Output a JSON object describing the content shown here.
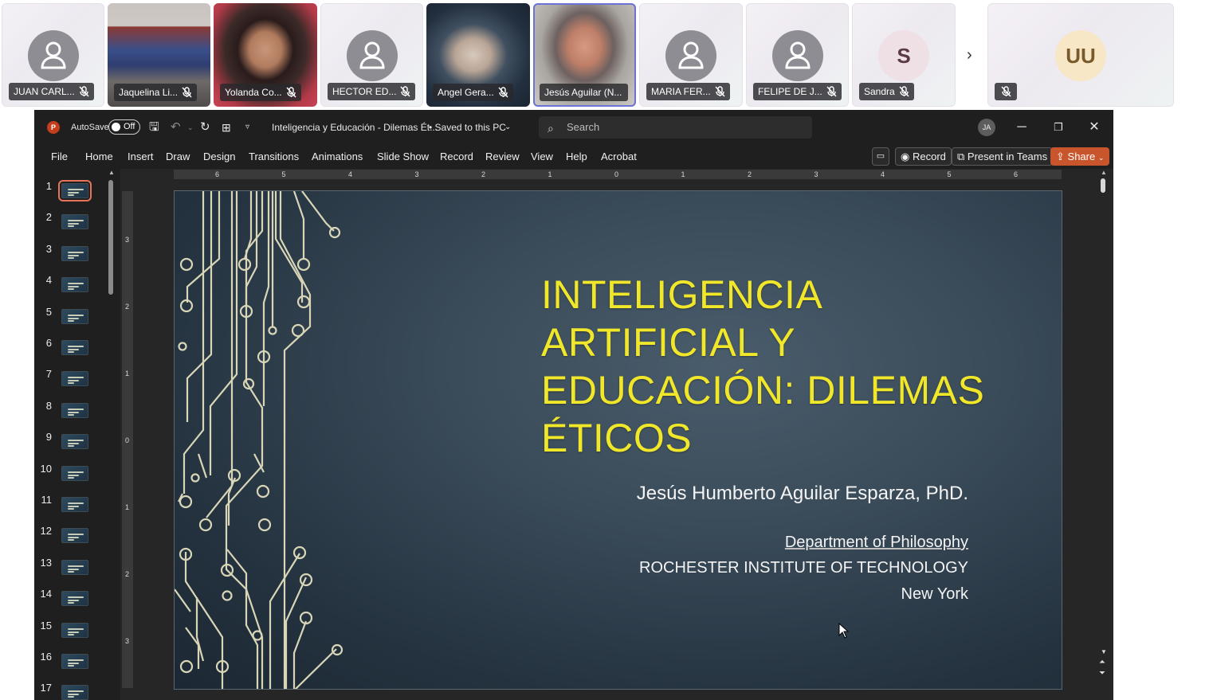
{
  "participants": [
    {
      "name": "JUAN CARL...",
      "kind": "placeholder"
    },
    {
      "name": "Jaquelina Li...",
      "kind": "video"
    },
    {
      "name": "Yolanda Co...",
      "kind": "video"
    },
    {
      "name": "HECTOR ED...",
      "kind": "placeholder"
    },
    {
      "name": "Angel Gera...",
      "kind": "video"
    },
    {
      "name": "Jesús Aguilar (N...",
      "kind": "video"
    },
    {
      "name": "MARIA FER...",
      "kind": "placeholder"
    },
    {
      "name": "FELIPE DE J...",
      "kind": "placeholder"
    },
    {
      "name": "Sandra",
      "kind": "initial",
      "initial": "S"
    },
    {
      "name": "",
      "kind": "initial",
      "initial": "UU"
    }
  ],
  "more_participants_icon": "chevron-right-icon",
  "window": {
    "app_logo": "P",
    "autosave_label": "AutoSave",
    "autosave_state": "Off",
    "doc_title": "Inteligencia y Educación - Dilemas Ét...",
    "save_status": "• Saved to this PC",
    "search_placeholder": "Search",
    "account_initials": "JA"
  },
  "menu": [
    "File",
    "Home",
    "Insert",
    "Draw",
    "Design",
    "Transitions",
    "Animations",
    "Slide Show",
    "Record",
    "Review",
    "View",
    "Help",
    "Acrobat"
  ],
  "ribbon_buttons": {
    "record": "Record",
    "present": "Present in Teams",
    "share": "Share"
  },
  "thumbnails": [
    "1",
    "2",
    "3",
    "4",
    "5",
    "6",
    "7",
    "8",
    "9",
    "10",
    "11",
    "12",
    "13",
    "14",
    "15",
    "16",
    "17"
  ],
  "selected_slide": 1,
  "ruler_h": [
    "6",
    "5",
    "4",
    "3",
    "2",
    "1",
    "0",
    "1",
    "2",
    "3",
    "4",
    "5",
    "6"
  ],
  "ruler_v": [
    "3",
    "2",
    "1",
    "0",
    "1",
    "2",
    "3"
  ],
  "slide": {
    "title": "INTELIGENCIA ARTIFICIAL Y EDUCACIÓN: DILEMAS ÉTICOS",
    "author": "Jesús Humberto Aguilar Esparza, PhD.",
    "department": "Department of Philosophy",
    "institution": "ROCHESTER INSTITUTE OF TECHNOLOGY",
    "city": "New York",
    "title_color": "#f0e62a"
  },
  "colors": {
    "accent": "#c9552c",
    "speaker_outline": "#6b74d6",
    "slide_bg": "#2e3e4c"
  }
}
